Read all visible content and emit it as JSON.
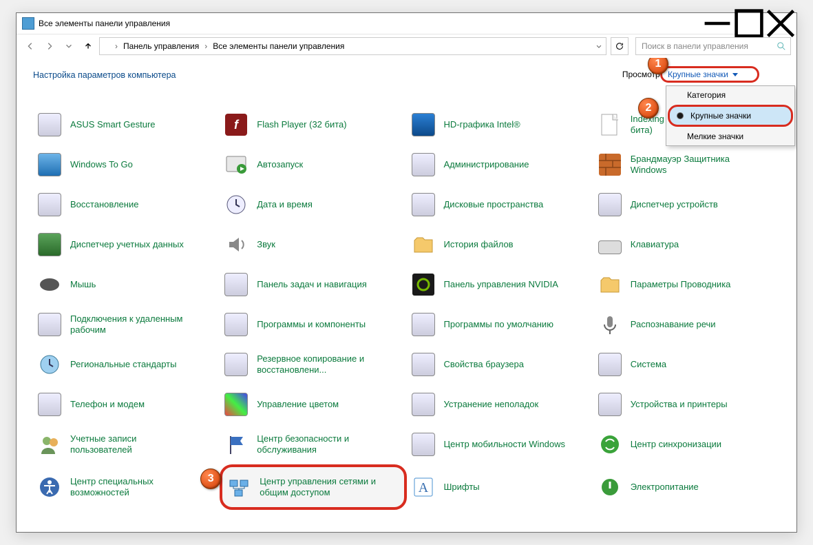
{
  "window": {
    "title": "Все элементы панели управления"
  },
  "breadcrumb": {
    "root": "Панель управления",
    "leaf": "Все элементы панели управления"
  },
  "search": {
    "placeholder": "Поиск в панели управления"
  },
  "heading": "Настройка параметров компьютера",
  "view": {
    "label": "Просмотр:",
    "selected": "Крупные значки"
  },
  "dropdown": {
    "opt0": "Категория",
    "opt1": "Крупные значки",
    "opt2": "Мелкие значки"
  },
  "badges": {
    "b1": "1",
    "b2": "2",
    "b3": "3"
  },
  "items": {
    "r0c0": "ASUS Smart Gesture",
    "r0c1": "Flash Player (32 бита)",
    "r0c2": "HD-графика Intel®",
    "r0c3": "Indexing Options Panel (32 бита)",
    "r1c0": "Windows To Go",
    "r1c1": "Автозапуск",
    "r1c2": "Администрирование",
    "r1c3": "Брандмауэр Защитника Windows",
    "r2c0": "Восстановление",
    "r2c1": "Дата и время",
    "r2c2": "Дисковые пространства",
    "r2c3": "Диспетчер устройств",
    "r3c0": "Диспетчер учетных данных",
    "r3c1": "Звук",
    "r3c2": "История файлов",
    "r3c3": "Клавиатура",
    "r4c0": "Мышь",
    "r4c1": "Панель задач и навигация",
    "r4c2": "Панель управления NVIDIA",
    "r4c3": "Параметры Проводника",
    "r5c0": "Подключения к удаленным рабочим",
    "r5c1": "Программы и компоненты",
    "r5c2": "Программы по умолчанию",
    "r5c3": "Распознавание речи",
    "r6c0": "Региональные стандарты",
    "r6c1": "Резервное копирование и восстановлени...",
    "r6c2": "Свойства браузера",
    "r6c3": "Система",
    "r7c0": "Телефон и модем",
    "r7c1": "Управление цветом",
    "r7c2": "Устранение неполадок",
    "r7c3": "Устройства и принтеры",
    "r8c0": "Учетные записи пользователей",
    "r8c1": "Центр безопасности и обслуживания",
    "r8c2": "Центр мобильности Windows",
    "r8c3": "Центр синхронизации",
    "r9c0": "Центр специальных возможностей",
    "r9c1": "Центр управления сетями и общим доступом",
    "r9c2": "Шрифты",
    "r9c3": "Электропитание"
  }
}
